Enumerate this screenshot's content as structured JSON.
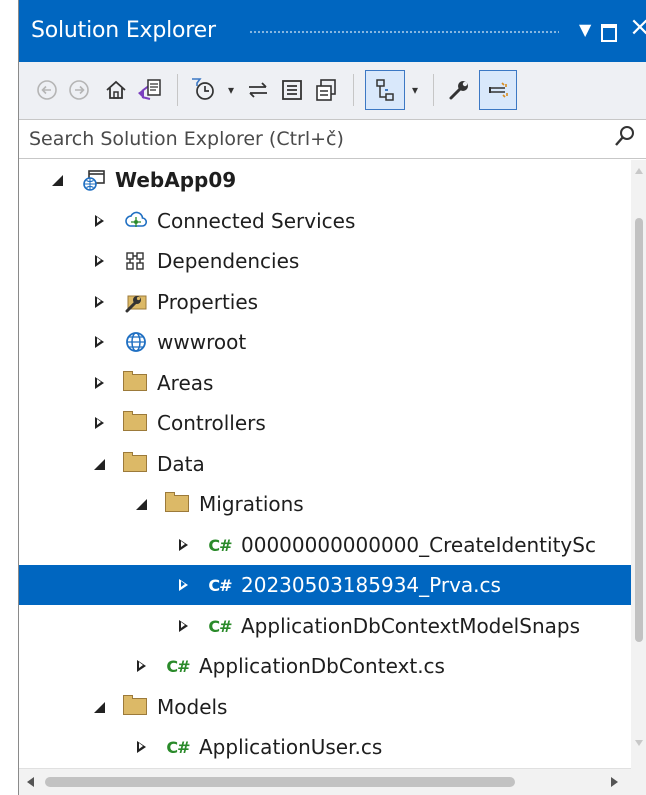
{
  "window": {
    "title": "Solution Explorer",
    "close_glyph": "×"
  },
  "toolbar": {
    "buttons": [
      {
        "name": "back-icon",
        "glyph": "⊖",
        "enabled": false
      },
      {
        "name": "forward-icon",
        "glyph": "⊕",
        "enabled": false
      },
      {
        "name": "home-icon",
        "glyph": "⌂",
        "enabled": true
      },
      {
        "name": "switch-views-icon",
        "glyph": "⇱",
        "enabled": true
      },
      {
        "name": "pending-changes-filter-icon",
        "glyph": "⏲",
        "enabled": true
      },
      {
        "name": "sync-with-active-document-icon",
        "glyph": "⇋",
        "enabled": true
      },
      {
        "name": "collapse-all-icon",
        "glyph": "⊟",
        "enabled": true
      },
      {
        "name": "show-all-files-icon",
        "glyph": "⧉",
        "enabled": true
      },
      {
        "name": "preview-selected-items-icon",
        "glyph": "⊡",
        "enabled": true,
        "selected": true
      },
      {
        "name": "properties-icon",
        "glyph": "🔧",
        "enabled": true
      },
      {
        "name": "pin-preview-icon",
        "glyph": "⊏",
        "enabled": true,
        "selected": true
      }
    ]
  },
  "search": {
    "placeholder": "Search Solution Explorer (Ctrl+č)",
    "value": ""
  },
  "tree": {
    "items": [
      {
        "label": "WebApp09",
        "level": 0,
        "state": "expanded",
        "icon": "project-icon",
        "bold": true
      },
      {
        "label": "Connected Services",
        "level": 1,
        "state": "collapsed",
        "icon": "connected-services-icon"
      },
      {
        "label": "Dependencies",
        "level": 1,
        "state": "collapsed",
        "icon": "dependencies-icon"
      },
      {
        "label": "Properties",
        "level": 1,
        "state": "collapsed",
        "icon": "properties-folder-icon"
      },
      {
        "label": "wwwroot",
        "level": 1,
        "state": "collapsed",
        "icon": "globe-icon"
      },
      {
        "label": "Areas",
        "level": 1,
        "state": "collapsed",
        "icon": "folder-icon"
      },
      {
        "label": "Controllers",
        "level": 1,
        "state": "collapsed",
        "icon": "folder-icon"
      },
      {
        "label": "Data",
        "level": 1,
        "state": "expanded",
        "icon": "folder-icon"
      },
      {
        "label": "Migrations",
        "level": 2,
        "state": "expanded",
        "icon": "folder-icon"
      },
      {
        "label": "00000000000000_CreateIdentitySc",
        "level": 3,
        "state": "collapsed",
        "icon": "csharp-file-icon"
      },
      {
        "label": "20230503185934_Prva.cs",
        "level": 3,
        "state": "collapsed",
        "icon": "csharp-file-icon",
        "selected": true
      },
      {
        "label": "ApplicationDbContextModelSnaps",
        "level": 3,
        "state": "collapsed",
        "icon": "csharp-file-icon"
      },
      {
        "label": "ApplicationDbContext.cs",
        "level": 2,
        "state": "collapsed",
        "icon": "csharp-file-icon"
      },
      {
        "label": "Models",
        "level": 1,
        "state": "expanded",
        "icon": "folder-icon"
      },
      {
        "label": "ApplicationUser.cs",
        "level": 2,
        "state": "collapsed",
        "icon": "csharp-file-icon"
      }
    ],
    "csharp_glyph": "C#"
  },
  "colors": {
    "title_bar": "#0066c0",
    "selection": "#0066c0",
    "csharp_icon": "#2a8a2a",
    "folder": "#dcb967"
  }
}
